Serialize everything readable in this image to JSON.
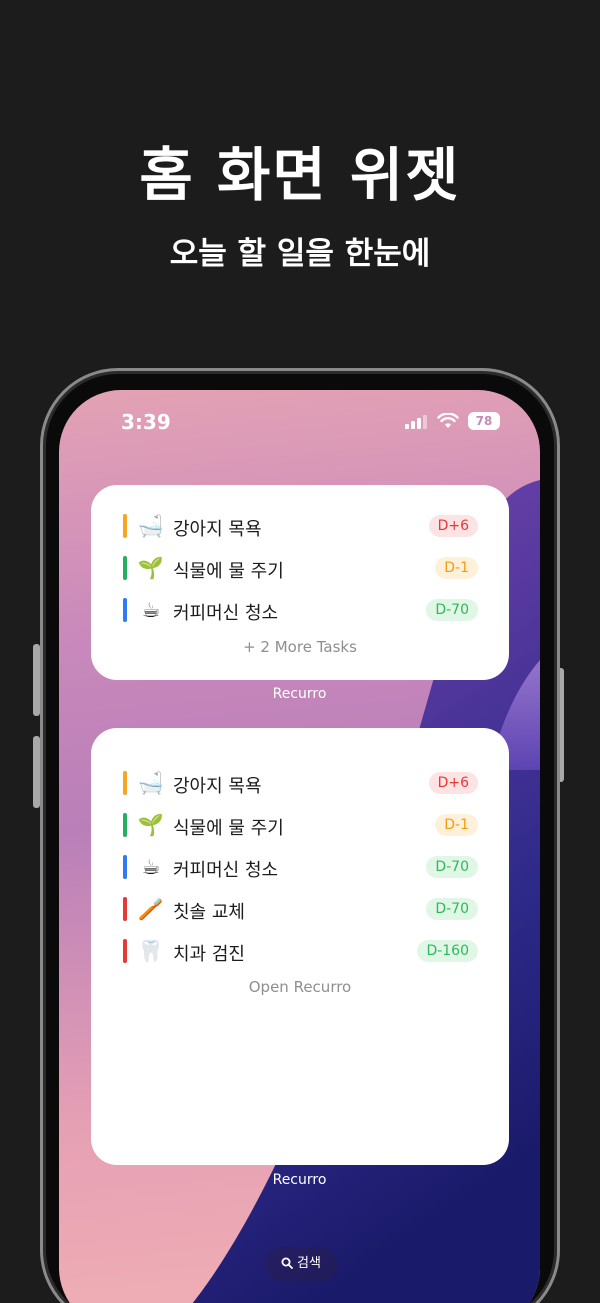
{
  "hero": {
    "title": "홈 화면 위젯",
    "subtitle": "오늘 할 일을 한눈에"
  },
  "status_bar": {
    "time": "3:39",
    "battery": "78"
  },
  "colors": {
    "orange": "#f5a623",
    "green": "#27ae60",
    "blue": "#2f7bf5",
    "red": "#e53935",
    "badge_red_bg": "#fde3e3",
    "badge_red_fg": "#e53935",
    "badge_orange_bg": "#fff1d9",
    "badge_orange_fg": "#f39c12",
    "badge_green_bg": "#e1f7e6",
    "badge_green_fg": "#2eb85c"
  },
  "widget_small": {
    "tasks": [
      {
        "emoji": "🛁",
        "name": "강아지 목욕",
        "badge": "D+6",
        "color": "orange",
        "status": "overdue"
      },
      {
        "emoji": "🌱",
        "name": "식물에 물 주기",
        "badge": "D-1",
        "color": "green",
        "status": "soon"
      },
      {
        "emoji": "☕",
        "name": "커피머신 청소",
        "badge": "D-70",
        "color": "blue",
        "status": "later"
      }
    ],
    "more_text": "+ 2 More Tasks",
    "app_label": "Recurro"
  },
  "widget_large": {
    "tasks": [
      {
        "emoji": "🛁",
        "name": "강아지 목욕",
        "badge": "D+6",
        "color": "orange",
        "status": "overdue"
      },
      {
        "emoji": "🌱",
        "name": "식물에 물 주기",
        "badge": "D-1",
        "color": "green",
        "status": "soon"
      },
      {
        "emoji": "☕",
        "name": "커피머신 청소",
        "badge": "D-70",
        "color": "blue",
        "status": "later"
      },
      {
        "emoji": "🪥",
        "name": "칫솔 교체",
        "badge": "D-70",
        "color": "red",
        "status": "later"
      },
      {
        "emoji": "🦷",
        "name": "치과 검진",
        "badge": "D-160",
        "color": "red",
        "status": "later"
      }
    ],
    "open_text": "Open Recurro",
    "app_label": "Recurro"
  },
  "search": {
    "label": "검색",
    "icon": "search-icon"
  }
}
